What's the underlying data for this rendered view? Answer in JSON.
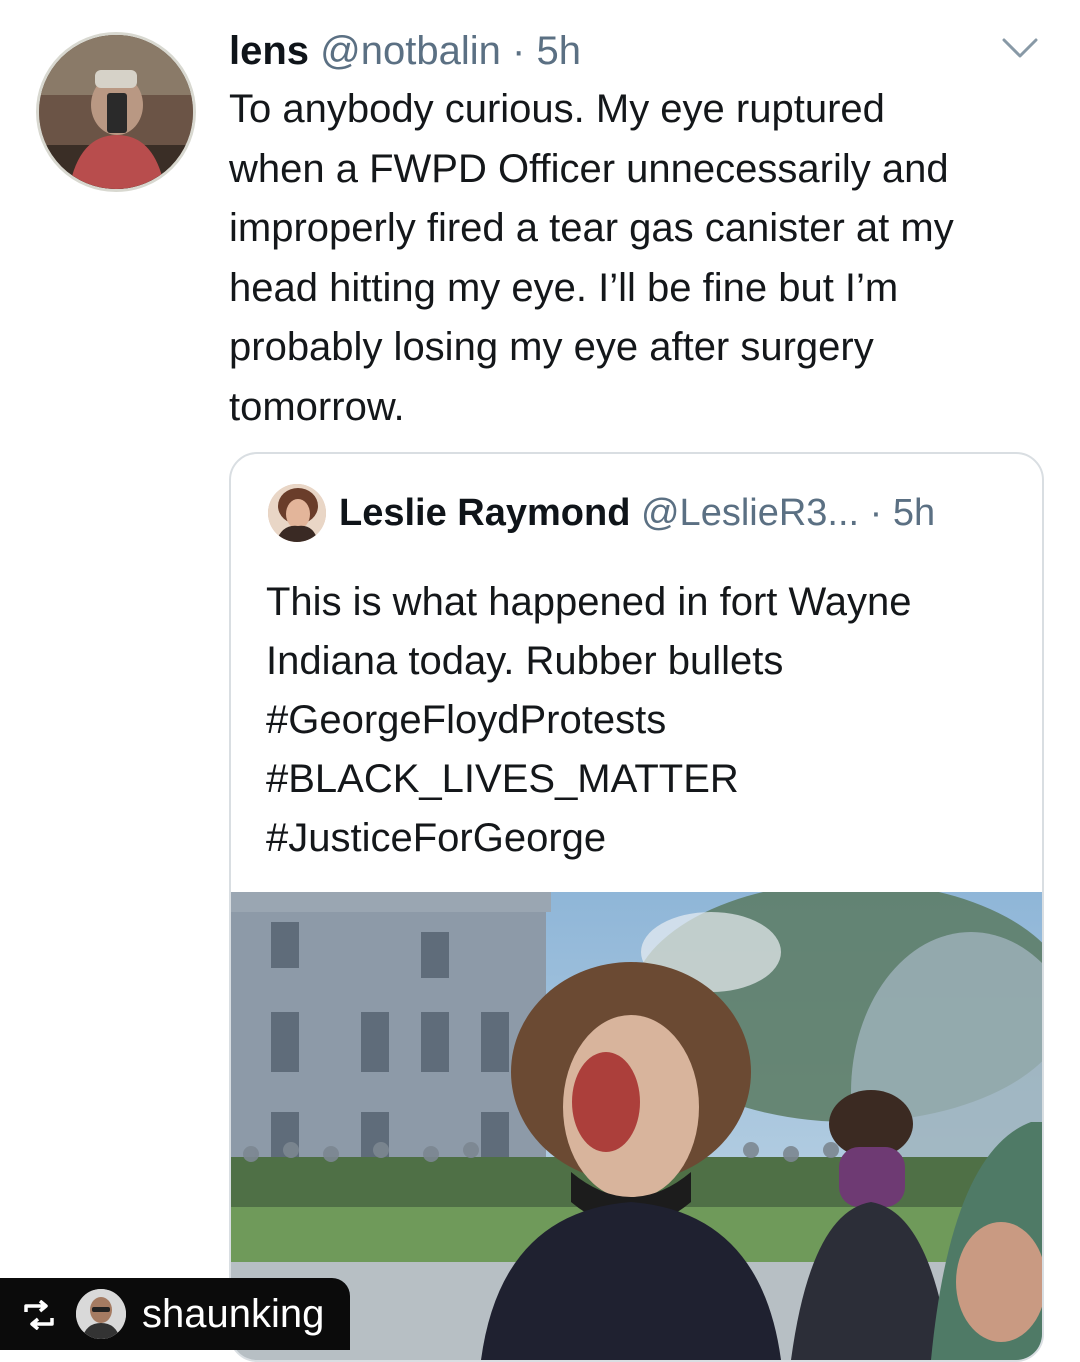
{
  "tweet": {
    "author_name": "lens",
    "handle": "@notbalin",
    "separator": "·",
    "time": "5h",
    "avatar_icon": "user-avatar-photo",
    "menu_icon": "chevron-down-icon",
    "lines": [
      "To anybody curious. My eye ruptured",
      "when a FWPD Officer unnecessarily and",
      "improperly fired a tear gas canister at my",
      "head hitting my eye. I’ll be fine but I’m",
      "probably losing my eye after surgery",
      "tomorrow."
    ]
  },
  "quoted_tweet": {
    "author_name": "Leslie Raymond",
    "handle": "@LeslieR3...",
    "separator": "·",
    "time": "5h",
    "avatar_icon": "user-avatar-photo",
    "lines": [
      "This is what happened in fort Wayne",
      "Indiana today. Rubber bullets",
      "#GeorgeFloydProtests",
      "#BLACK_LIVES_MATTER",
      "#JusticeForGeorge"
    ],
    "photo_icon": "protest-photo-image"
  },
  "repost_badge": {
    "icon": "repost-icon",
    "username": "shaunking"
  },
  "colors": {
    "text": "#0f1419",
    "muted": "#5b7083",
    "border": "#d9dee2",
    "badge_bg": "#0b0b0b"
  }
}
